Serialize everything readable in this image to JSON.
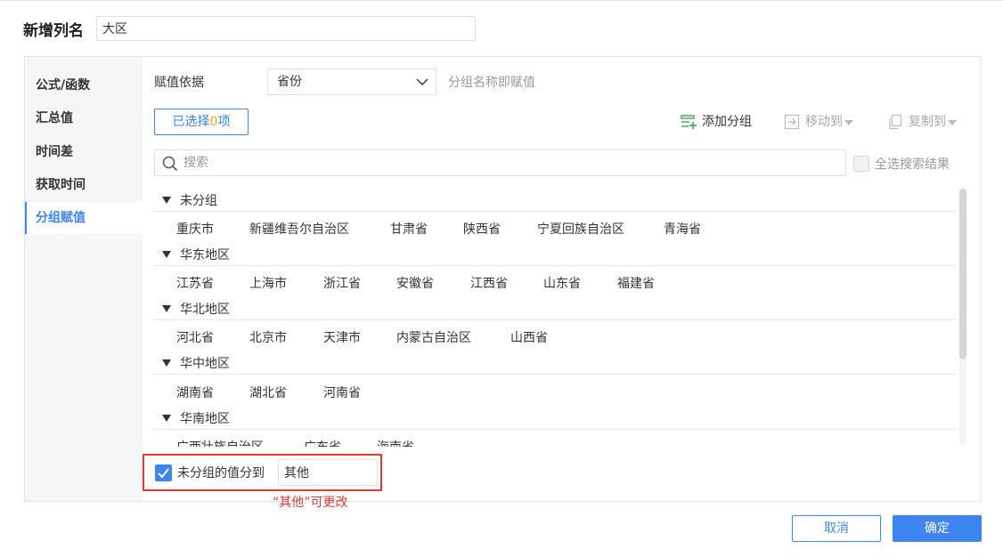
{
  "dialog": {
    "name_label": "新增列名",
    "name_value": "大区"
  },
  "sidebar": {
    "items": [
      {
        "label": "公式/函数",
        "active": false
      },
      {
        "label": "汇总值",
        "active": false
      },
      {
        "label": "时间差",
        "active": false
      },
      {
        "label": "获取时间",
        "active": false
      },
      {
        "label": "分组赋值",
        "active": true
      }
    ]
  },
  "basis": {
    "label": "赋值依据",
    "selected": "省份",
    "hint": "分组名称即赋值"
  },
  "toolbar": {
    "selected_prefix": "已选择",
    "selected_count": "0",
    "selected_suffix": "项",
    "add_group": "添加分组",
    "move_to": "移动到",
    "copy_to": "复制到"
  },
  "search": {
    "placeholder": "搜索",
    "select_all": "全选搜索结果"
  },
  "groups": [
    {
      "name": "未分组",
      "items": [
        "重庆市",
        "新疆维吾尔自治区",
        "甘肃省",
        "陕西省",
        "宁夏回族自治区",
        "青海省"
      ]
    },
    {
      "name": "华东地区",
      "items": [
        "江苏省",
        "上海市",
        "浙江省",
        "安徽省",
        "江西省",
        "山东省",
        "福建省"
      ]
    },
    {
      "name": "华北地区",
      "items": [
        "河北省",
        "北京市",
        "天津市",
        "内蒙古自治区",
        "山西省"
      ]
    },
    {
      "name": "华中地区",
      "items": [
        "湖南省",
        "湖北省",
        "河南省"
      ]
    },
    {
      "name": "华南地区",
      "items": [
        "广西壮族自治区",
        "广东省",
        "海南省"
      ]
    }
  ],
  "ungrouped": {
    "checked": true,
    "label": "未分组的值分到",
    "value": "其他"
  },
  "annotation": "“其他”可更改",
  "footer": {
    "cancel": "取消",
    "confirm": "确定"
  },
  "colors": {
    "accent": "#3d86f2",
    "highlight": "#e53935",
    "count": "#f5a623"
  }
}
